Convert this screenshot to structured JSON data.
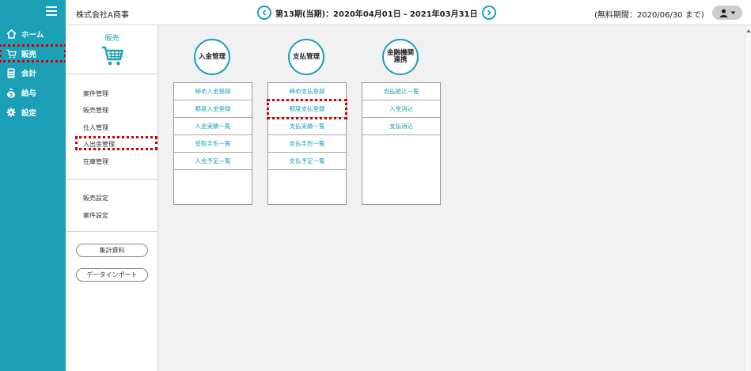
{
  "header": {
    "company": "株式会社A商事",
    "period": "第13期(当期)：2020年04月01日 - 2021年03月31日",
    "trial": "(無料期間：2020/06/30 まで)"
  },
  "sidebar": {
    "items": [
      {
        "label": "ホーム",
        "icon": "home-icon"
      },
      {
        "label": "販売",
        "icon": "cart-icon"
      },
      {
        "label": "会計",
        "icon": "calculator-icon"
      },
      {
        "label": "給与",
        "icon": "money-bag-icon"
      },
      {
        "label": "設定",
        "icon": "gear-icon"
      }
    ]
  },
  "submenu": {
    "title": "販売",
    "links": [
      "案件管理",
      "販売管理",
      "仕入管理",
      "入出金管理",
      "在庫管理"
    ],
    "settings": [
      "販売設定",
      "案件設定"
    ],
    "buttons": [
      "集計資料",
      "データインポート"
    ]
  },
  "groups": [
    {
      "title": "入金管理",
      "items": [
        "締め入金登録",
        "都度入金登録",
        "入金実績一覧",
        "受取手形一覧",
        "入金予定一覧"
      ]
    },
    {
      "title": "支払管理",
      "items": [
        "締め支払登録",
        "都度支払登録",
        "支払実績一覧",
        "支払手形一覧",
        "支払予定一覧"
      ]
    },
    {
      "title": "金融機関連携",
      "items": [
        "支払振込一覧",
        "入金消込",
        "支払消込"
      ]
    }
  ],
  "colors": {
    "accent": "#1ca0b8",
    "highlight": "#d40000"
  }
}
